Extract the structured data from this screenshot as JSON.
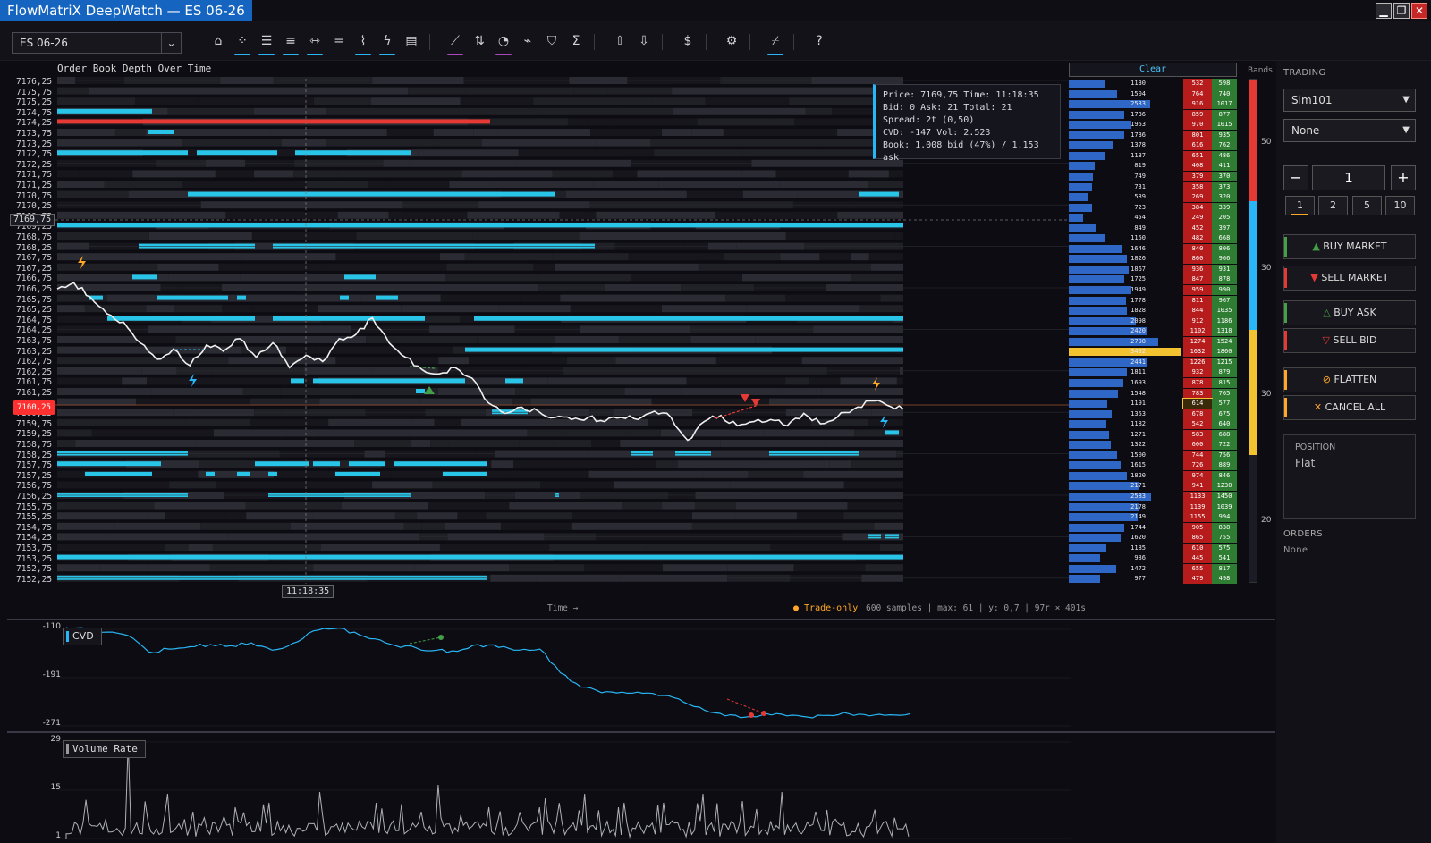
{
  "window": {
    "title": "FlowMatriX DeepWatch — ES 06-26",
    "minimize": "▁",
    "restore": "❐",
    "close": "✕"
  },
  "toolbar": {
    "symbol": "ES 06-26",
    "icons": [
      "home-icon",
      "cluster-icon",
      "align-left-icon",
      "align-bars-icon",
      "arrows-horizontal-icon",
      "equals-icon",
      "steps-icon",
      "bolt-icon",
      "rows-icon",
      "trend-icon",
      "sort-icon",
      "gauge-icon",
      "pulse-icon",
      "shield-icon",
      "sigma-icon",
      "arrow-up-icon",
      "arrow-down-icon",
      "dollar-icon",
      "gear-icon",
      "line-tool-icon",
      "help-icon"
    ]
  },
  "chart": {
    "title": "Order Book Depth Over Time",
    "price_labels": [
      "7176,25",
      "7175,75",
      "7175,25",
      "7174,75",
      "7174,25",
      "7173,75",
      "7173,25",
      "7172,75",
      "7172,25",
      "7171,75",
      "7171,25",
      "7170,75",
      "7170,25",
      "7169,75",
      "7169,25",
      "7168,75",
      "7168,25",
      "7167,75",
      "7167,25",
      "7166,75",
      "7166,25",
      "7165,75",
      "7165,25",
      "7164,75",
      "7164,25",
      "7163,75",
      "7163,25",
      "7162,75",
      "7162,25",
      "7161,75",
      "7161,25",
      "7160,75",
      "7160,25",
      "7159,75",
      "7159,25",
      "7158,75",
      "7158,25",
      "7157,75",
      "7157,25",
      "7156,75",
      "7156,25",
      "7155,75",
      "7155,25",
      "7154,75",
      "7154,25",
      "7153,75",
      "7153,25",
      "7152,75",
      "7152,25"
    ],
    "crosshair_price": "7169,75",
    "current_price": "7160,25",
    "crosshair_time": "11:18:35",
    "time_axis": "Time →",
    "trade_only": "● Trade-only",
    "stats": "600 samples | max: 61 | y: 0,7 | 97r × 401s"
  },
  "info_box": {
    "line1": "Price: 7169,75  Time: 11:18:35",
    "line2": "Bid: 0  Ask: 21  Total: 21",
    "line3": "Spread: 2t (0,50)",
    "line4": "CVD: -147  Vol: 2.523",
    "line5": "Book: 1.008 bid (47%) / 1.153 ask"
  },
  "ladder": {
    "clear_label": "Clear",
    "rows": [
      {
        "n": "1130",
        "b": "532",
        "a": "598"
      },
      {
        "n": "1504",
        "b": "764",
        "a": "740"
      },
      {
        "n": "2533",
        "b": "916",
        "a": "1017"
      },
      {
        "n": "1736",
        "b": "859",
        "a": "877"
      },
      {
        "n": "1953",
        "b": "970",
        "a": "1015"
      },
      {
        "n": "1736",
        "b": "801",
        "a": "935"
      },
      {
        "n": "1378",
        "b": "616",
        "a": "762"
      },
      {
        "n": "1137",
        "b": "651",
        "a": "486"
      },
      {
        "n": "819",
        "b": "408",
        "a": "411"
      },
      {
        "n": "749",
        "b": "379",
        "a": "370"
      },
      {
        "n": "731",
        "b": "358",
        "a": "373"
      },
      {
        "n": "589",
        "b": "269",
        "a": "320"
      },
      {
        "n": "723",
        "b": "384",
        "a": "339"
      },
      {
        "n": "454",
        "b": "249",
        "a": "205"
      },
      {
        "n": "849",
        "b": "452",
        "a": "397"
      },
      {
        "n": "1150",
        "b": "482",
        "a": "668"
      },
      {
        "n": "1646",
        "b": "840",
        "a": "806"
      },
      {
        "n": "1826",
        "b": "860",
        "a": "966"
      },
      {
        "n": "1867",
        "b": "936",
        "a": "931"
      },
      {
        "n": "1725",
        "b": "847",
        "a": "878"
      },
      {
        "n": "1949",
        "b": "959",
        "a": "990"
      },
      {
        "n": "1778",
        "b": "811",
        "a": "967"
      },
      {
        "n": "1828",
        "b": "844",
        "a": "1035"
      },
      {
        "n": "2098",
        "b": "912",
        "a": "1186"
      },
      {
        "n": "2420",
        "b": "1102",
        "a": "1318"
      },
      {
        "n": "2798",
        "b": "1274",
        "a": "1524"
      },
      {
        "n": "3492",
        "b": "1632",
        "a": "1860"
      },
      {
        "n": "2441",
        "b": "1226",
        "a": "1215"
      },
      {
        "n": "1811",
        "b": "932",
        "a": "879"
      },
      {
        "n": "1693",
        "b": "878",
        "a": "815"
      },
      {
        "n": "1548",
        "b": "783",
        "a": "765"
      },
      {
        "n": "1191",
        "b": "614",
        "a": "577"
      },
      {
        "n": "1353",
        "b": "678",
        "a": "675"
      },
      {
        "n": "1182",
        "b": "542",
        "a": "640"
      },
      {
        "n": "1271",
        "b": "583",
        "a": "688"
      },
      {
        "n": "1322",
        "b": "600",
        "a": "722"
      },
      {
        "n": "1500",
        "b": "744",
        "a": "756"
      },
      {
        "n": "1615",
        "b": "726",
        "a": "889"
      },
      {
        "n": "1820",
        "b": "974",
        "a": "846"
      },
      {
        "n": "2171",
        "b": "941",
        "a": "1230"
      },
      {
        "n": "2583",
        "b": "1133",
        "a": "1450"
      },
      {
        "n": "2178",
        "b": "1139",
        "a": "1039"
      },
      {
        "n": "2149",
        "b": "1155",
        "a": "994"
      },
      {
        "n": "1744",
        "b": "905",
        "a": "838"
      },
      {
        "n": "1620",
        "b": "865",
        "a": "755"
      },
      {
        "n": "1185",
        "b": "610",
        "a": "575"
      },
      {
        "n": "986",
        "b": "445",
        "a": "541"
      },
      {
        "n": "1472",
        "b": "655",
        "a": "817"
      },
      {
        "n": "977",
        "b": "479",
        "a": "498"
      }
    ],
    "highlight_index": 26,
    "boxed_index": 31
  },
  "bands": {
    "label": "Bands",
    "ticks": [
      "50",
      "30",
      "30",
      "20"
    ]
  },
  "trading": {
    "header": "TRADING",
    "account": "Sim101",
    "atm": "None",
    "qty": "1",
    "minus": "−",
    "plus": "+",
    "presets": [
      "1",
      "2",
      "5",
      "10"
    ],
    "buy_market": "BUY MARKET",
    "sell_market": "SELL MARKET",
    "buy_ask": "BUY ASK",
    "sell_bid": "SELL BID",
    "flatten": "FLATTEN",
    "cancel_all": "CANCEL ALL",
    "position_label": "POSITION",
    "position_value": "Flat",
    "orders_label": "ORDERS",
    "orders_value": "None"
  },
  "cvd": {
    "legend": "CVD",
    "ticks": [
      "-110",
      "-191",
      "-271"
    ]
  },
  "volume": {
    "legend": "Volume Rate",
    "ticks": [
      "29",
      "15",
      "1"
    ]
  },
  "colors": {
    "accent": "#29b6f6",
    "sell": "#e53935",
    "buy": "#43a047",
    "warning": "#ffa726",
    "bid_bar": "#2e67c5",
    "highlight": "#f2c230"
  },
  "chart_data": {
    "type": "line",
    "title": "Order Book Depth Over Time",
    "xlabel": "Time →",
    "ylim": [
      7152.25,
      7176.25
    ],
    "price_series_approx": [
      7166.2,
      7166.5,
      7165.8,
      7165.0,
      7164.6,
      7163.6,
      7162.8,
      7163.3,
      7162.5,
      7163.5,
      7163.2,
      7163.8,
      7162.9,
      7163.6,
      7162.4,
      7163.0,
      7162.7,
      7163.8,
      7164.0,
      7164.8,
      7163.6,
      7162.9,
      7162.3,
      7162.1,
      7162.4,
      7161.9,
      7160.7,
      7160.2,
      7160.5,
      7160.3,
      7160.0,
      7159.9,
      7160.0,
      7159.8,
      7160.0,
      7159.9,
      7160.3,
      7160.0,
      7158.9,
      7159.8,
      7160.1,
      7159.6,
      7159.8,
      7159.9,
      7159.6,
      7160.2,
      7159.7,
      7160.0,
      7160.4,
      7160.8,
      7160.6,
      7160.4
    ],
    "cvd_ylim": [
      -271,
      -110
    ],
    "cvd_series_approx": [
      -110,
      -112,
      -118,
      -124,
      -153,
      -148,
      -144,
      -140,
      -142,
      -137,
      -150,
      -138,
      -116,
      -112,
      -118,
      -130,
      -142,
      -146,
      -150,
      -152,
      -140,
      -145,
      -150,
      -148,
      -190,
      -215,
      -225,
      -224,
      -226,
      -230,
      -242,
      -256,
      -266,
      -268,
      -262,
      -266,
      -268,
      -265,
      -262,
      -266,
      -264,
      -262
    ],
    "volume_ylim": [
      1,
      29
    ]
  }
}
